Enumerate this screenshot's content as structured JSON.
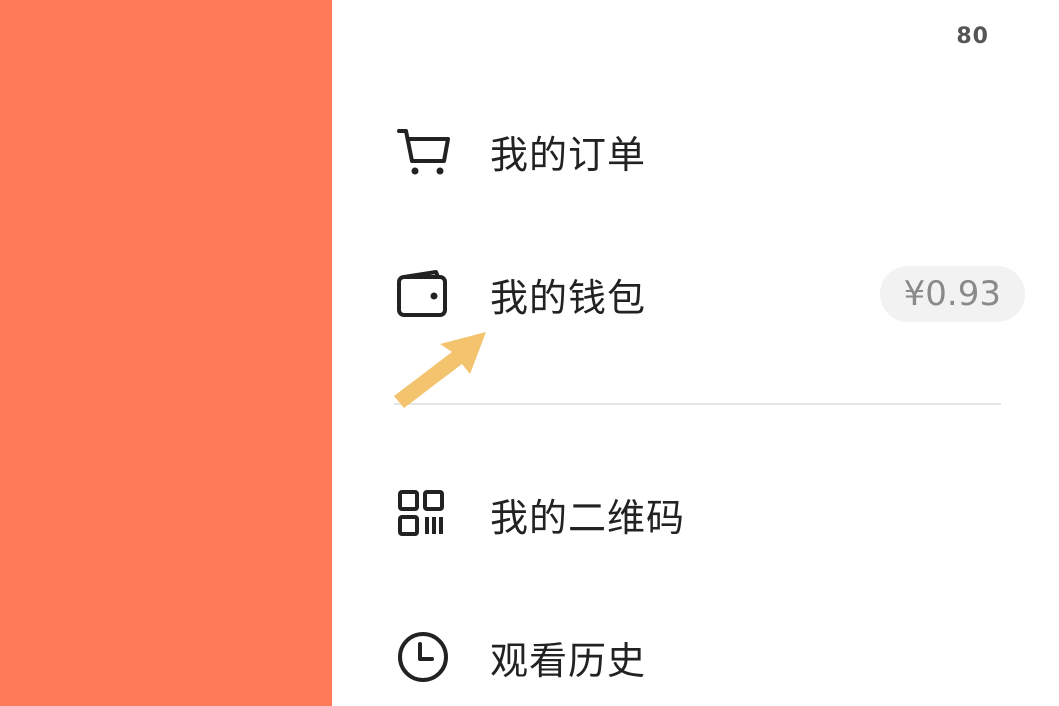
{
  "left_panel": {
    "color": "#ff7a59"
  },
  "header": {
    "count": "80"
  },
  "menu": {
    "items": [
      {
        "label": "我的订单",
        "icon": "cart-icon"
      },
      {
        "label": "我的钱包",
        "icon": "wallet-icon",
        "badge": "¥0.93"
      },
      {
        "label": "我的二维码",
        "icon": "qr-code-icon"
      },
      {
        "label": "观看历史",
        "icon": "clock-icon"
      }
    ]
  },
  "annotation": {
    "icon": "arrow-pointer-icon",
    "color": "#f3c36d"
  }
}
